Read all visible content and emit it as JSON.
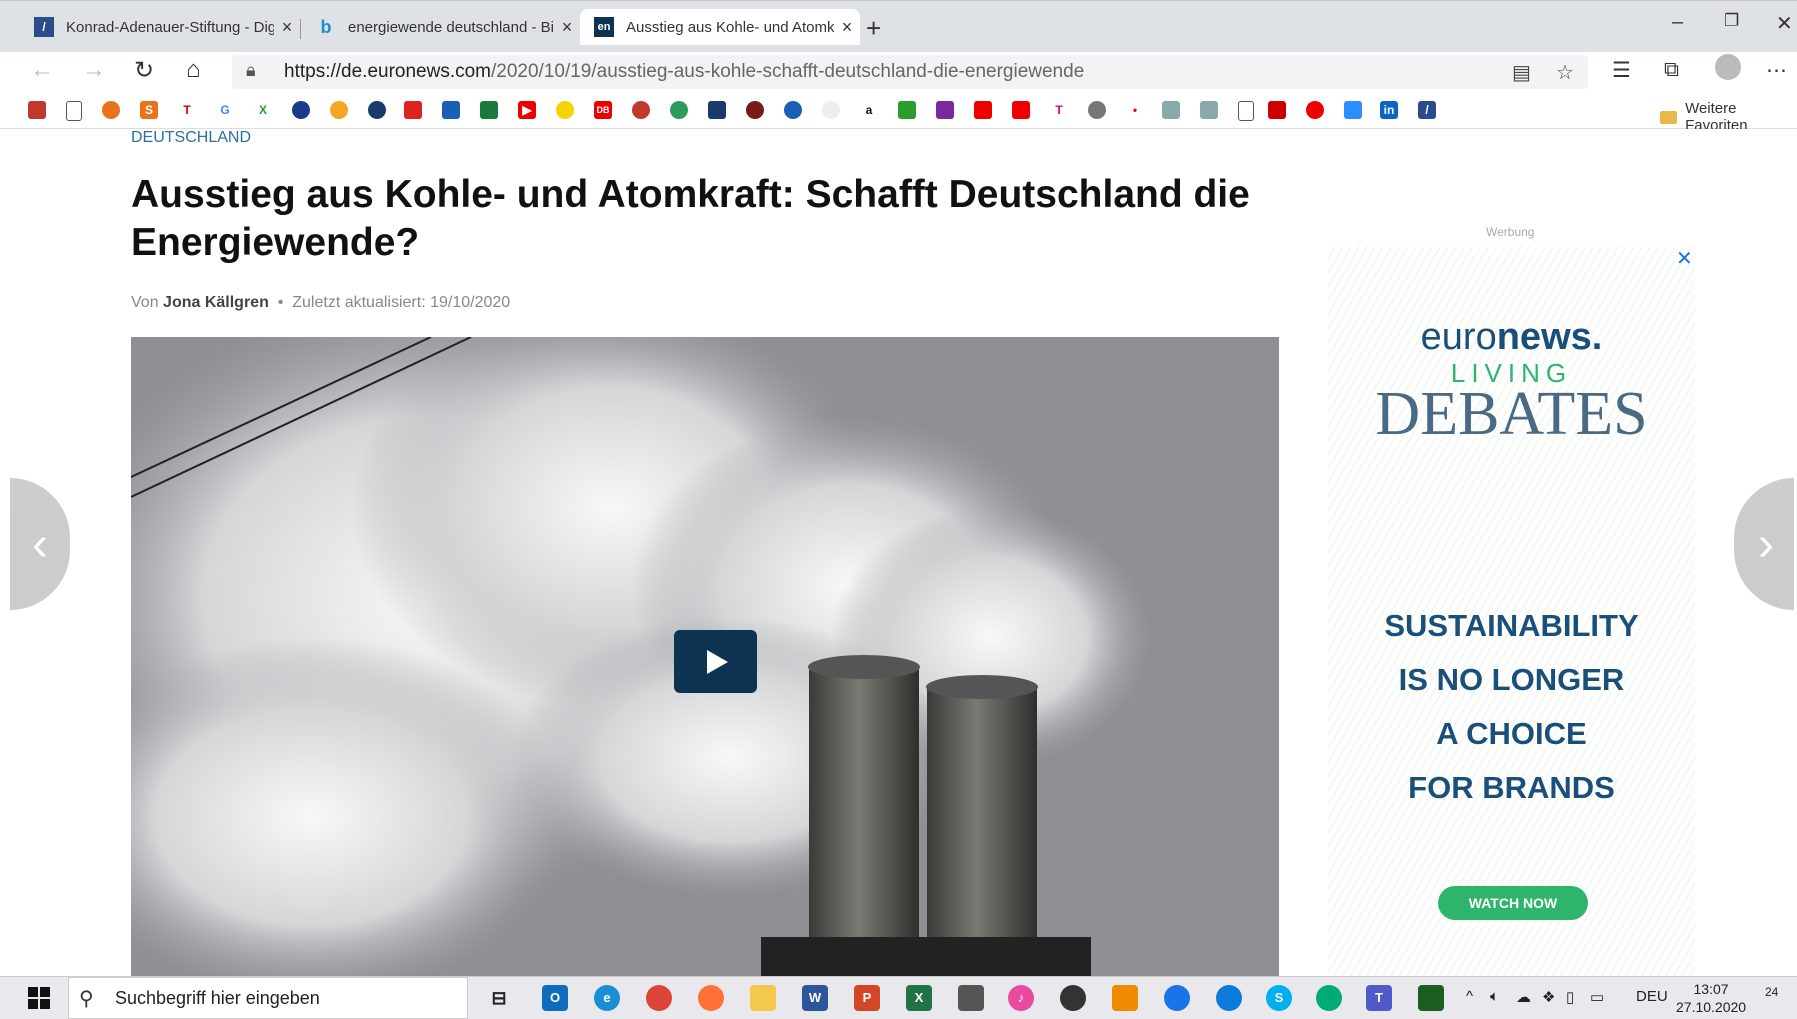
{
  "browser": {
    "tabs": [
      {
        "title": "Konrad-Adenauer-Stiftung - Digi",
        "favicon": "kas-icon",
        "active": false
      },
      {
        "title": "energiewende deutschland - Bin",
        "favicon": "bing-icon",
        "active": false
      },
      {
        "title": "Ausstieg aus Kohle- und Atomkr",
        "favicon": "euronews-icon",
        "active": true
      }
    ],
    "url_host": "https://de.euronews.com",
    "url_path": "/2020/10/19/ausstieg-aus-kohle-schafft-deutschland-die-energiewende",
    "bookmarks_more_label": "Weitere Favoriten"
  },
  "article": {
    "section": "DEUTSCHLAND",
    "title": "Ausstieg aus Kohle- und Atomkraft: Schafft Deutschland die Energiewende?",
    "byline_prefix": "Von",
    "author": "Jona Källgren",
    "separator": "•",
    "updated": "Zuletzt aktualisiert: 19/10/2020"
  },
  "ad": {
    "label": "Werbung",
    "brand_light": "euro",
    "brand_bold": "news.",
    "sub": "LIVING",
    "title": "DEBATES",
    "slogan_lines": [
      "SUSTAINABILITY",
      "IS NO LONGER",
      "A CHOICE",
      "FOR BRANDS"
    ],
    "cta": "WATCH NOW"
  },
  "taskbar": {
    "search_placeholder": "Suchbegriff hier eingeben",
    "language": "DEU",
    "time": "13:07",
    "date": "27.10.2020",
    "notifications": "24"
  },
  "colors": {
    "link_blue": "#2a6f9e",
    "play_button": "#0d3350",
    "ad_green": "#2fb56b",
    "ad_navy": "#1a4f7a"
  }
}
